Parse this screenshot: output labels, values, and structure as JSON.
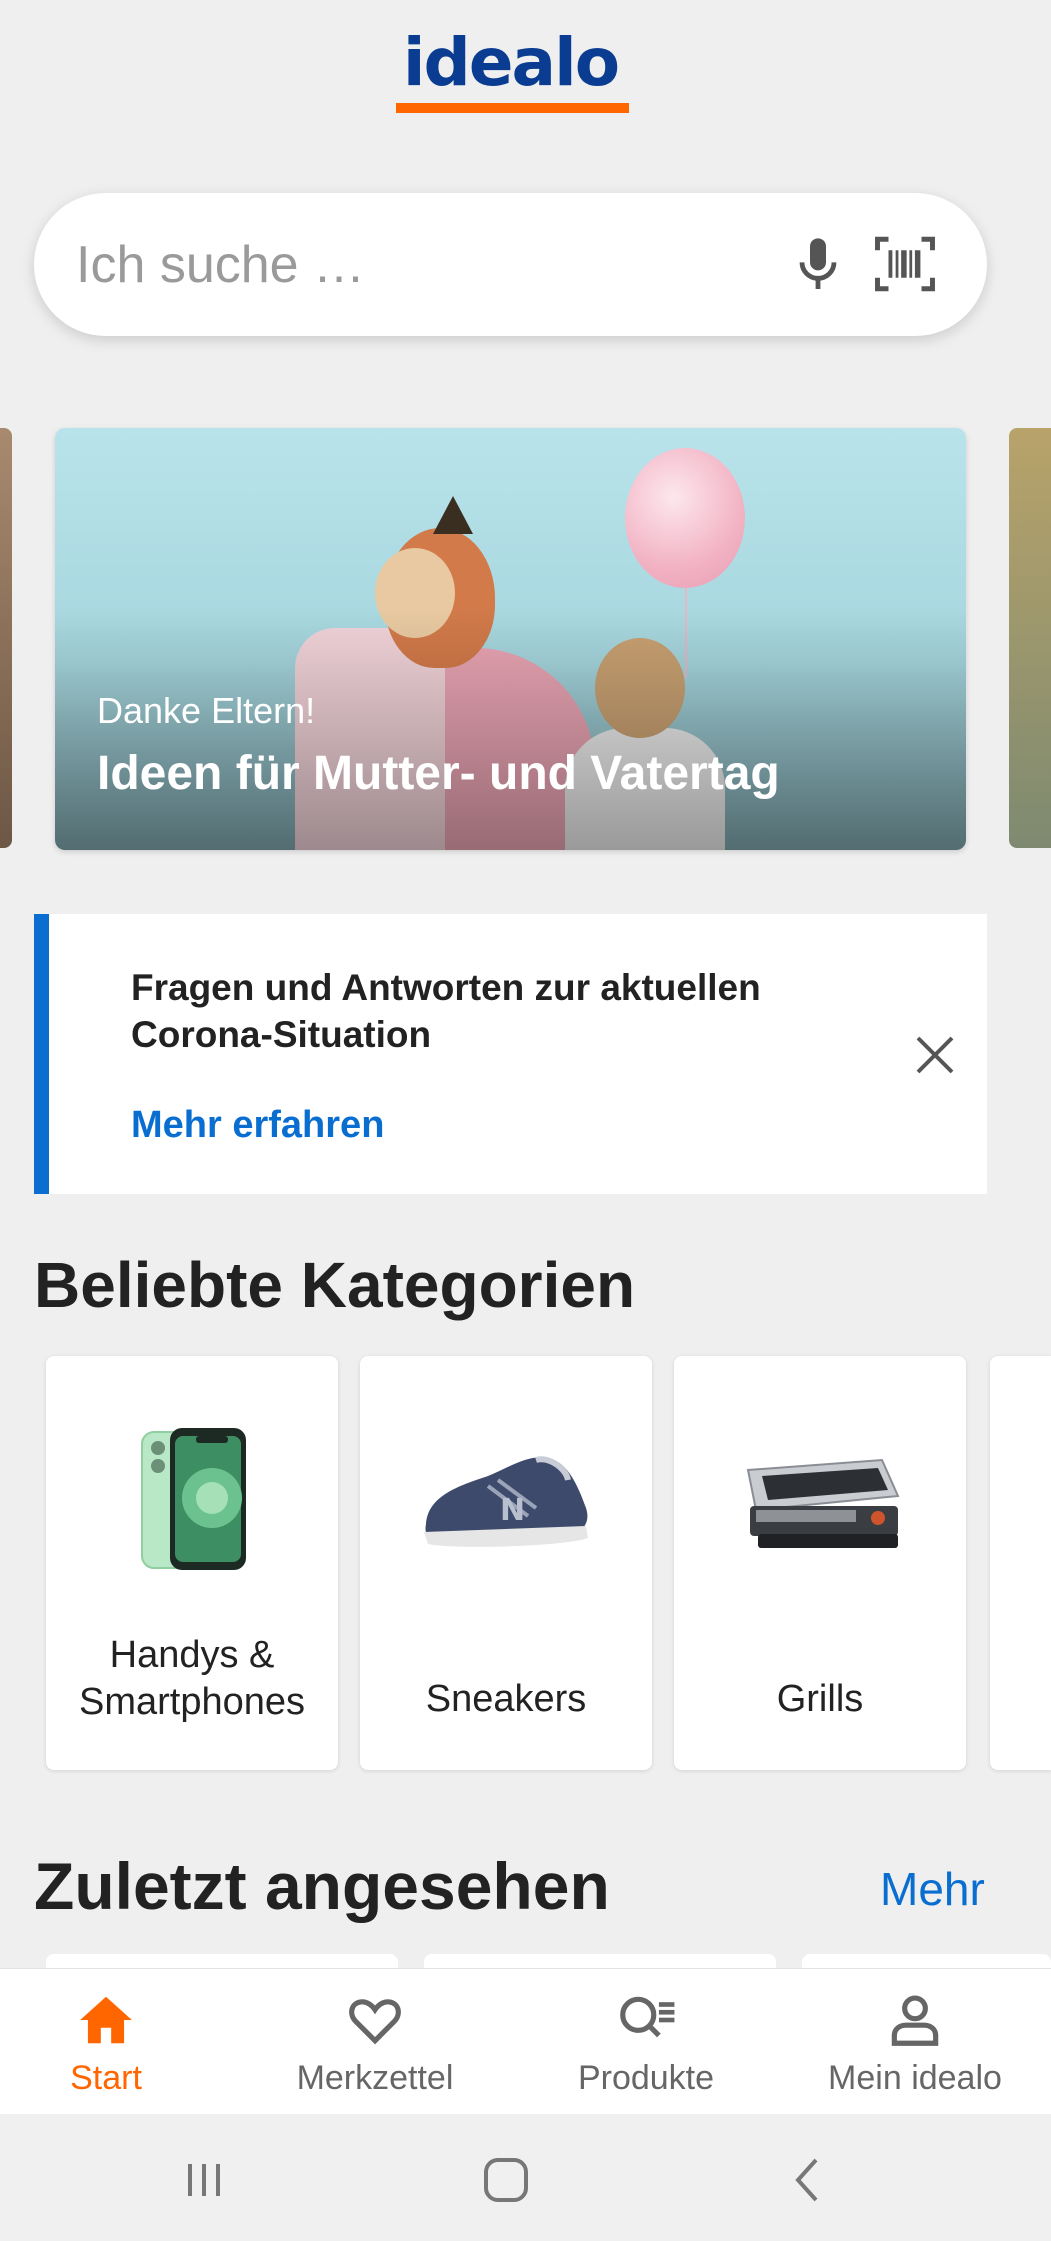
{
  "brand": {
    "logo_text": "idealo",
    "logo_color": "#0a3d91",
    "accent_color": "#ff6600"
  },
  "search": {
    "placeholder": "Ich suche …",
    "mic_icon": "microphone-icon",
    "scan_icon": "barcode-scan-icon"
  },
  "banner": {
    "subtitle": "Danke Eltern!",
    "title": "Ideen für Mutter- und Vatertag"
  },
  "notice": {
    "text": "Fragen und Antworten zur aktuellen Corona-Situation",
    "link": "Mehr erfahren",
    "link_color": "#0a6ed1"
  },
  "categories": {
    "title": "Beliebte Kategorien",
    "items": [
      {
        "label": "Handys & Smartphones",
        "icon": "smartphone-image"
      },
      {
        "label": "Sneakers",
        "icon": "sneaker-image"
      },
      {
        "label": "Grills",
        "icon": "grill-image"
      }
    ]
  },
  "recent": {
    "title": "Zuletzt angesehen",
    "more": "Mehr"
  },
  "bottom_nav": {
    "items": [
      {
        "label": "Start",
        "icon": "home-icon",
        "active": true
      },
      {
        "label": "Merkzettel",
        "icon": "heart-icon",
        "active": false
      },
      {
        "label": "Produkte",
        "icon": "product-search-icon",
        "active": false
      },
      {
        "label": "Mein idealo",
        "icon": "user-icon",
        "active": false
      }
    ]
  },
  "system_nav": {
    "buttons": [
      "recent-apps-icon",
      "home-button-icon",
      "back-icon"
    ]
  }
}
